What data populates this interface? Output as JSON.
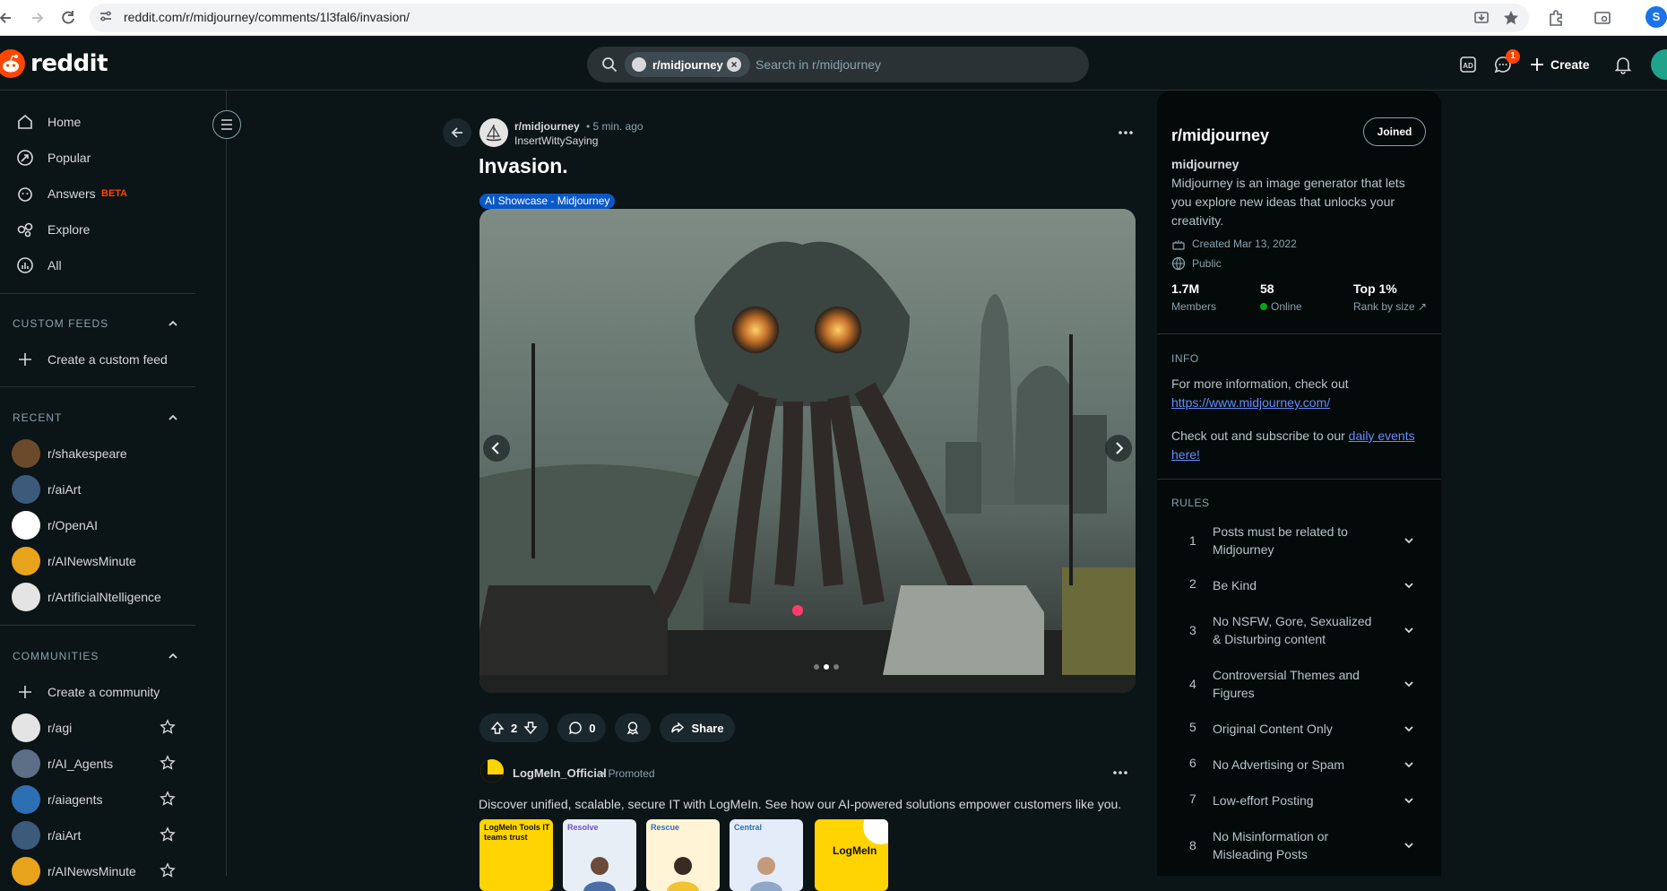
{
  "browser": {
    "url": "reddit.com/r/midjourney/comments/1l3fal6/invasion/",
    "profile_initial": "S"
  },
  "header": {
    "logo_text": "reddit",
    "search_chip": "r/midjourney",
    "search_placeholder": "Search in r/midjourney",
    "notification_count": "1",
    "create_label": "Create"
  },
  "sidebar": {
    "nav": [
      {
        "label": "Home",
        "icon": "home-icon"
      },
      {
        "label": "Popular",
        "icon": "popular-icon"
      },
      {
        "label": "Answers",
        "icon": "answers-icon",
        "badge": "BETA"
      },
      {
        "label": "Explore",
        "icon": "explore-icon"
      },
      {
        "label": "All",
        "icon": "all-icon"
      }
    ],
    "custom_feeds": {
      "heading": "CUSTOM FEEDS",
      "create_label": "Create a custom feed"
    },
    "recent": {
      "heading": "RECENT",
      "items": [
        "r/shakespeare",
        "r/aiArt",
        "r/OpenAI",
        "r/AINewsMinute",
        "r/ArtificialNtelligence"
      ]
    },
    "communities": {
      "heading": "COMMUNITIES",
      "create_label": "Create a community",
      "items": [
        "r/agi",
        "r/AI_Agents",
        "r/aiagents",
        "r/aiArt",
        "r/AINewsMinute"
      ]
    }
  },
  "post": {
    "subreddit": "r/midjourney",
    "time": "• 5 min. ago",
    "author": "InsertWittySaying",
    "title": "Invasion.",
    "flair": "AI Showcase - Midjourney",
    "image_alt": "giant octopus robot in city street",
    "upvotes": "2",
    "comments": "0",
    "share_label": "Share",
    "carousel_index": 2,
    "carousel_total": 3
  },
  "ad": {
    "name": "LogMeIn_Official",
    "promoted": "Promoted",
    "text": "Discover unified, scalable, secure IT with LogMeIn. See how our AI-powered solutions empower customers like you.",
    "thumbs": [
      {
        "text": "LogMeIn\nTools IT teams trust",
        "bg": "#ffd400"
      },
      {
        "text": "Resolve",
        "bg": "#e8eef5"
      },
      {
        "text": "Rescue",
        "bg": "#fff4d6"
      },
      {
        "text": "Central",
        "bg": "#e3ecf8"
      },
      {
        "text": "LogMeIn",
        "bg": "#ffd400"
      }
    ]
  },
  "community": {
    "title": "r/midjourney",
    "joined_label": "Joined",
    "name": "midjourney",
    "description": "Midjourney is an image generator that lets you explore new ideas that unlocks your creativity.",
    "created": "Created Mar 13, 2022",
    "visibility": "Public",
    "members_value": "1.7M",
    "members_label": "Members",
    "online_value": "58",
    "online_label": "Online",
    "rank_value": "Top 1%",
    "rank_label": "Rank by size",
    "info_heading": "INFO",
    "info_text1": "For more information, check out",
    "info_link": "https://www.midjourney.com/",
    "info_text2": "Check out and subscribe to our",
    "info_link2": "daily events here!",
    "rules_heading": "RULES",
    "rules": [
      {
        "num": "1",
        "text": "Posts must be related to Midjourney"
      },
      {
        "num": "2",
        "text": "Be Kind"
      },
      {
        "num": "3",
        "text": "No NSFW, Gore, Sexualized & Disturbing content"
      },
      {
        "num": "4",
        "text": "Controversial Themes and Figures"
      },
      {
        "num": "5",
        "text": "Original Content Only"
      },
      {
        "num": "6",
        "text": "No Advertising or Spam"
      },
      {
        "num": "7",
        "text": "Low-effort Posting"
      },
      {
        "num": "8",
        "text": "No Misinformation or Misleading Posts"
      }
    ]
  }
}
